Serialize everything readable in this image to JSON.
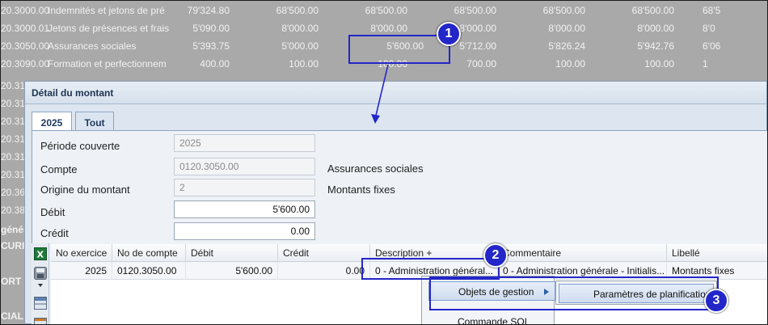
{
  "background_table": {
    "rows": [
      {
        "code": "20.3000.00",
        "name": "Indemnités et jetons de pré",
        "values": [
          "79'324.80",
          "68'500.00",
          "68'500.00",
          "68'500.00",
          "68'500.00",
          "68'500.00",
          "68'5"
        ]
      },
      {
        "code": "20.3000.01",
        "name": "Jetons de présences et frais",
        "values": [
          "5'090.00",
          "8'000.00",
          "8'000.00",
          "8'000.00",
          "8'000.00",
          "8'000.00",
          "8'0"
        ]
      },
      {
        "code": "20.3050.00",
        "name": "Assurances sociales",
        "values": [
          "5'393.75",
          "5'000.00",
          "5'600.00",
          "5'712.00",
          "5'826.24",
          "5'942.76",
          "6'06"
        ]
      },
      {
        "code": "20.3090.00",
        "name": "Formation et perfectionnem",
        "values": [
          "400.00",
          "100.00",
          "100.00",
          "700.00",
          "100.00",
          "100.00",
          "1"
        ]
      }
    ],
    "side_labels": [
      "20.31",
      "20.31",
      "20.31",
      "20.31",
      "20.31",
      "20.31",
      "20.39",
      "20.49",
      "20.31",
      "20.36",
      "20.38",
      "génér",
      "CURI",
      "ORT",
      "CIAL"
    ]
  },
  "dialog": {
    "title": "Détail du montant",
    "tabs": [
      {
        "label": "2025",
        "active": true
      },
      {
        "label": "Tout",
        "active": false
      }
    ],
    "fields": {
      "periode_label": "Période couverte",
      "periode_value": "2025",
      "compte_label": "Compte",
      "compte_value": "0120.3050.00",
      "compte_desc": "Assurances sociales",
      "origine_label": "Origine du montant",
      "origine_value": "2",
      "origine_desc": "Montants fixes",
      "debit_label": "Débit",
      "debit_value": "5'600.00",
      "credit_label": "Crédit",
      "credit_value": "0.00"
    },
    "grid": {
      "headers": [
        "No exercice",
        "No de compte",
        "Débit",
        "Crédit",
        "Description +",
        "Commentaire",
        "Libellé"
      ],
      "rows": [
        [
          "2025",
          "0120.3050.00",
          "5'600.00",
          "0.00",
          "0 - Administration général...",
          "0 - Administration générale - Initialis...",
          "Montants fixes"
        ]
      ]
    }
  },
  "context_menu": {
    "items": [
      "Objets de gestion",
      "Commande SQL"
    ],
    "submenu_items": [
      "Paramètres de planification"
    ]
  },
  "annotations": [
    "1",
    "2",
    "3"
  ],
  "colors": {
    "annotation": "#2326c8",
    "dialog_bg": "#dde6f0",
    "overlay": "#a9a9a9"
  },
  "icons": [
    "excel-icon",
    "save-icon",
    "dropdown-arrow-icon",
    "panel-icon",
    "submenu-arrow-icon"
  ]
}
